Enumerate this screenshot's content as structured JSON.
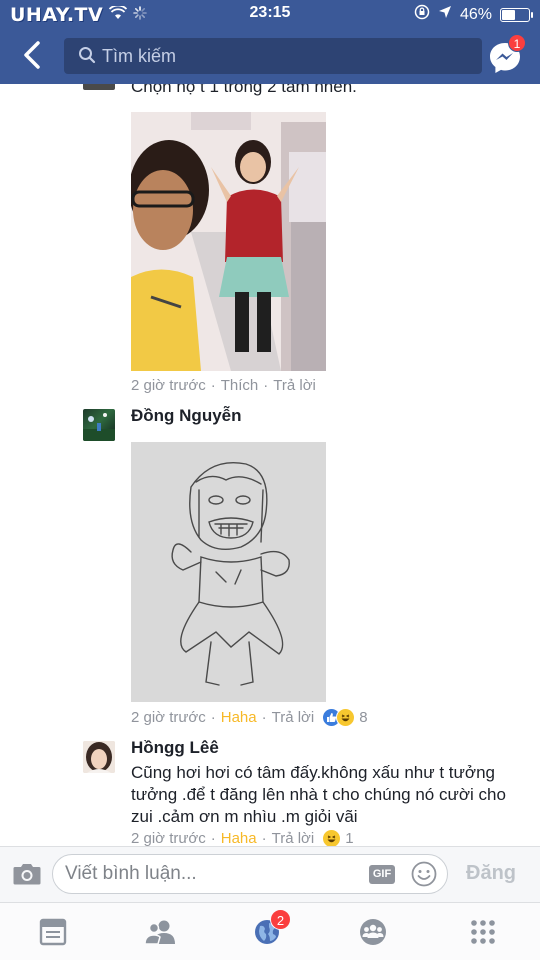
{
  "status_bar": {
    "watermark": "UHAY.TV",
    "time": "23:15",
    "battery": "46%",
    "battery_level": 0.46
  },
  "nav": {
    "back_icon": "chevron-left-icon",
    "search_placeholder": "Tìm kiếm",
    "messenger_badge": "1"
  },
  "comments": [
    {
      "text": "Chọn nọ t 1 trong 2 tấm nhen.",
      "time": "2 giờ trước",
      "like": "Thích",
      "reply": "Trả lời",
      "separator": "·"
    },
    {
      "author": "Đồng Nguyễn",
      "time": "2 giờ trước",
      "reaction_label": "Haha",
      "reply": "Trả lời",
      "reactions_count": "8",
      "separator": "·"
    },
    {
      "author": "Hồngg Lêê",
      "text": "Cũng hơi hơi có tâm đấy.không xấu như t tưởng tưởng .để t đăng lên nhà t cho chúng nó cười cho zui  .cảm ơn m nhìu .m giỏi vãi",
      "time": "2 giờ trước",
      "reaction_label": "Haha",
      "reply": "Trả lời",
      "reactions_count": "1",
      "separator": "·"
    }
  ],
  "composer": {
    "placeholder": "Viết bình luận...",
    "gif_label": "GIF",
    "post_label": "Đăng"
  },
  "tabbar": {
    "notifications_badge": "2"
  },
  "colors": {
    "brand": "#3b5998",
    "haha": "#f7b928",
    "badge": "#fa3e3e"
  }
}
